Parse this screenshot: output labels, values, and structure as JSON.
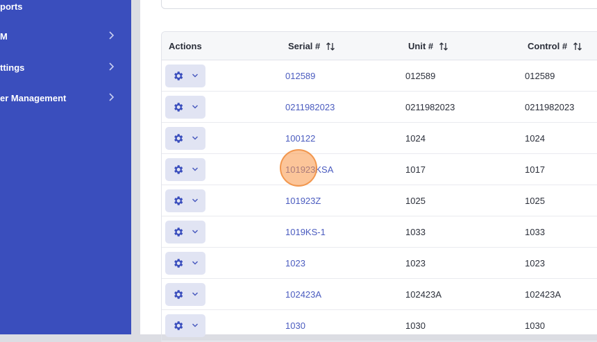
{
  "sidebar": {
    "items": [
      {
        "label": "ports",
        "has_chevron": false
      },
      {
        "label": "M",
        "has_chevron": true
      },
      {
        "label": "ttings",
        "has_chevron": true
      },
      {
        "label": "er Management",
        "has_chevron": true
      }
    ]
  },
  "table": {
    "headers": {
      "actions": "Actions",
      "serial": "Serial #",
      "unit": "Unit #",
      "control": "Control #"
    },
    "rows": [
      {
        "serial": "012589",
        "unit": "012589",
        "control": "012589"
      },
      {
        "serial": "0211982023",
        "unit": "0211982023",
        "control": "0211982023"
      },
      {
        "serial": "100122",
        "unit": "1024",
        "control": "1024"
      },
      {
        "serial": "101923KSA",
        "unit": "1017",
        "control": "1017"
      },
      {
        "serial": "101923Z",
        "unit": "1025",
        "control": "1025"
      },
      {
        "serial": "1019KS-1",
        "unit": "1033",
        "control": "1033"
      },
      {
        "serial": "1023",
        "unit": "1023",
        "control": "1023"
      },
      {
        "serial": "102423A",
        "unit": "102423A",
        "control": "102423A"
      },
      {
        "serial": "1030",
        "unit": "1030",
        "control": "1030"
      }
    ]
  },
  "icons": {
    "action_button": "gear-icon",
    "action_caret": "chevron-down-icon",
    "sort": "sort-arrows-icon",
    "nav_chevron": "chevron-right-icon"
  },
  "colors": {
    "sidebar_bg": "#3a4ebd",
    "link": "#4a5bbf",
    "action_button_bg": "#e1e4f3",
    "gear": "#3a4ebd",
    "click_marker": "#f5a060"
  }
}
